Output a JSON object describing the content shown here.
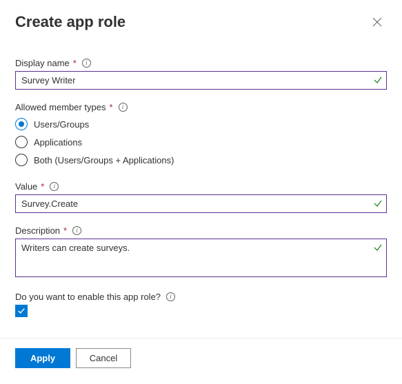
{
  "header": {
    "title": "Create app role"
  },
  "fields": {
    "display_name": {
      "label": "Display name",
      "value": "Survey Writer"
    },
    "member_types": {
      "label": "Allowed member types",
      "options": [
        "Users/Groups",
        "Applications",
        "Both (Users/Groups + Applications)"
      ],
      "selected_index": 0
    },
    "value": {
      "label": "Value",
      "value": "Survey.Create"
    },
    "description": {
      "label": "Description",
      "value": "Writers can create surveys."
    },
    "enable": {
      "label": "Do you want to enable this app role?",
      "checked": true
    }
  },
  "footer": {
    "apply": "Apply",
    "cancel": "Cancel"
  }
}
